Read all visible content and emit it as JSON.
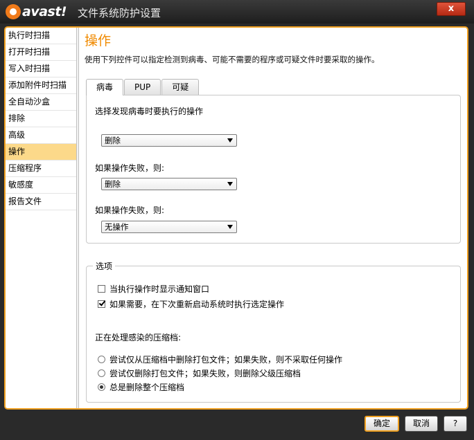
{
  "window": {
    "brand": "avast!",
    "title": "文件系统防护设置",
    "close": "x"
  },
  "sidebar": {
    "items": [
      {
        "label": "执行时扫描"
      },
      {
        "label": "打开时扫描"
      },
      {
        "label": "写入时扫描"
      },
      {
        "label": "添加附件时扫描"
      },
      {
        "label": "全自动沙盒"
      },
      {
        "label": "排除"
      },
      {
        "label": "高级"
      },
      {
        "label": "操作",
        "active": true
      },
      {
        "label": "压缩程序"
      },
      {
        "label": "敏感度"
      },
      {
        "label": "报告文件"
      }
    ]
  },
  "main": {
    "title": "操作",
    "description": "使用下列控件可以指定检测到病毒、可能不需要的程序或可疑文件时要采取的操作。",
    "tabs": [
      {
        "label": "病毒",
        "active": true
      },
      {
        "label": "PUP"
      },
      {
        "label": "可疑"
      }
    ],
    "virus_panel": {
      "heading": "选择发现病毒时要执行的操作",
      "action1": {
        "value": "删除"
      },
      "fallback1_label": "如果操作失败，则:",
      "action2": {
        "value": "删除"
      },
      "fallback2_label": "如果操作失败，则:",
      "action3": {
        "value": "无操作"
      }
    },
    "options": {
      "legend": "选项",
      "show_notification": {
        "label": "当执行操作时显示通知窗口",
        "checked": false
      },
      "reboot_if_needed": {
        "label": "如果需要，在下次重新启动系统时执行选定操作",
        "checked": true
      },
      "archive_heading": "正在处理感染的压缩档:",
      "archive_options": [
        {
          "label": "尝试仅从压缩档中删除打包文件；如果失败，则不采取任何操作",
          "selected": false
        },
        {
          "label": "尝试仅删除打包文件；如果失败，则删除父级压缩档",
          "selected": false
        },
        {
          "label": "总是删除整个压缩档",
          "selected": true
        }
      ]
    }
  },
  "footer": {
    "ok_label": "确定",
    "cancel_label": "取消",
    "help_label": "?"
  },
  "colors": {
    "accent": "#f0a020",
    "title": "#f08a00",
    "sidebar_active": "#fcd98a"
  }
}
